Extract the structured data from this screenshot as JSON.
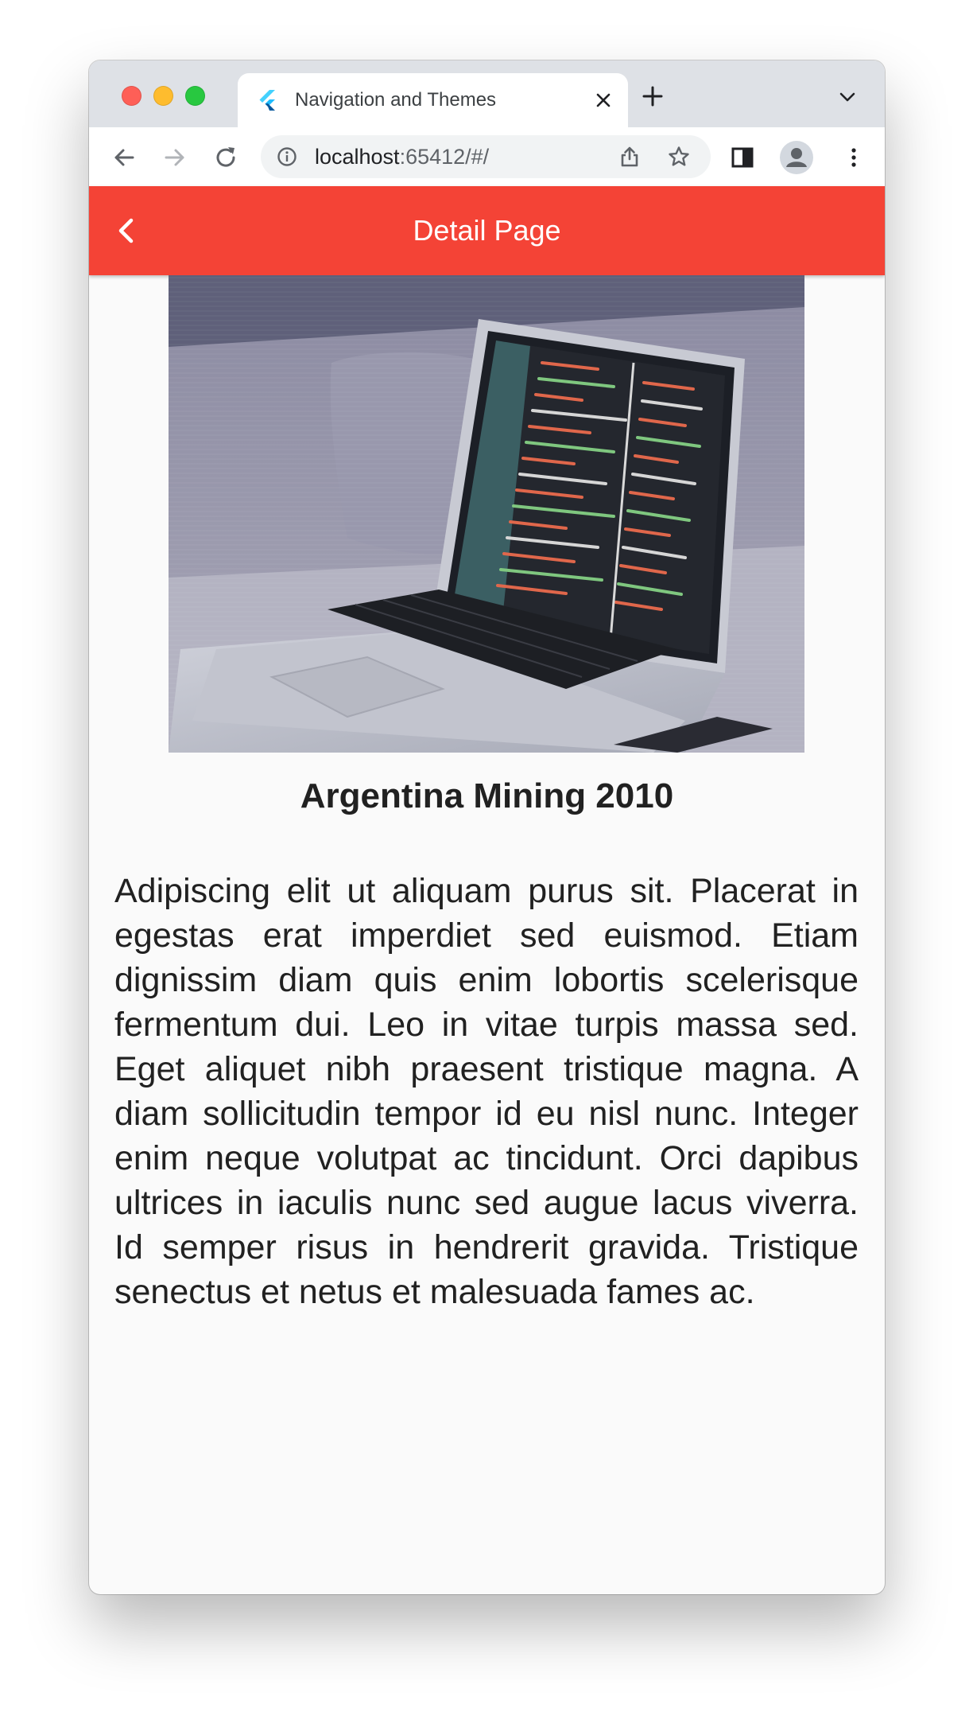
{
  "browser": {
    "tab_title": "Navigation and Themes",
    "url_host": "localhost",
    "url_rest": ":65412/#/",
    "icons": {
      "back": "arrow-left-icon",
      "forward": "arrow-right-icon",
      "reload": "reload-icon",
      "info": "info-icon",
      "share": "share-icon",
      "bookmark": "star-icon",
      "side_panel": "side-panel-icon",
      "profile": "profile-icon",
      "menu": "kebab-menu-icon",
      "new_tab": "plus-icon",
      "tab_close": "close-icon",
      "tab_search": "chevron-down-icon"
    }
  },
  "app": {
    "appbar_title": "Detail Page",
    "appbar_color": "#f44336",
    "headline": "Argentina Mining 2010",
    "body": "Adipiscing elit ut aliquam purus sit. Placerat in egestas erat imperdiet sed euismod. Etiam dignissim diam quis enim lobortis scelerisque fermentum dui. Leo in vitae turpis massa sed. Eget aliquet nibh praesent tristique magna. A diam sollicitudin tempor id eu nisl nunc. Integer enim neque volutpat ac tincidunt. Orci dapibus ultrices in iaculis nunc sed augue lacus viverra. Id semper risus in hendrerit gravida. Tristique senectus et netus et malesuada fames ac."
  }
}
